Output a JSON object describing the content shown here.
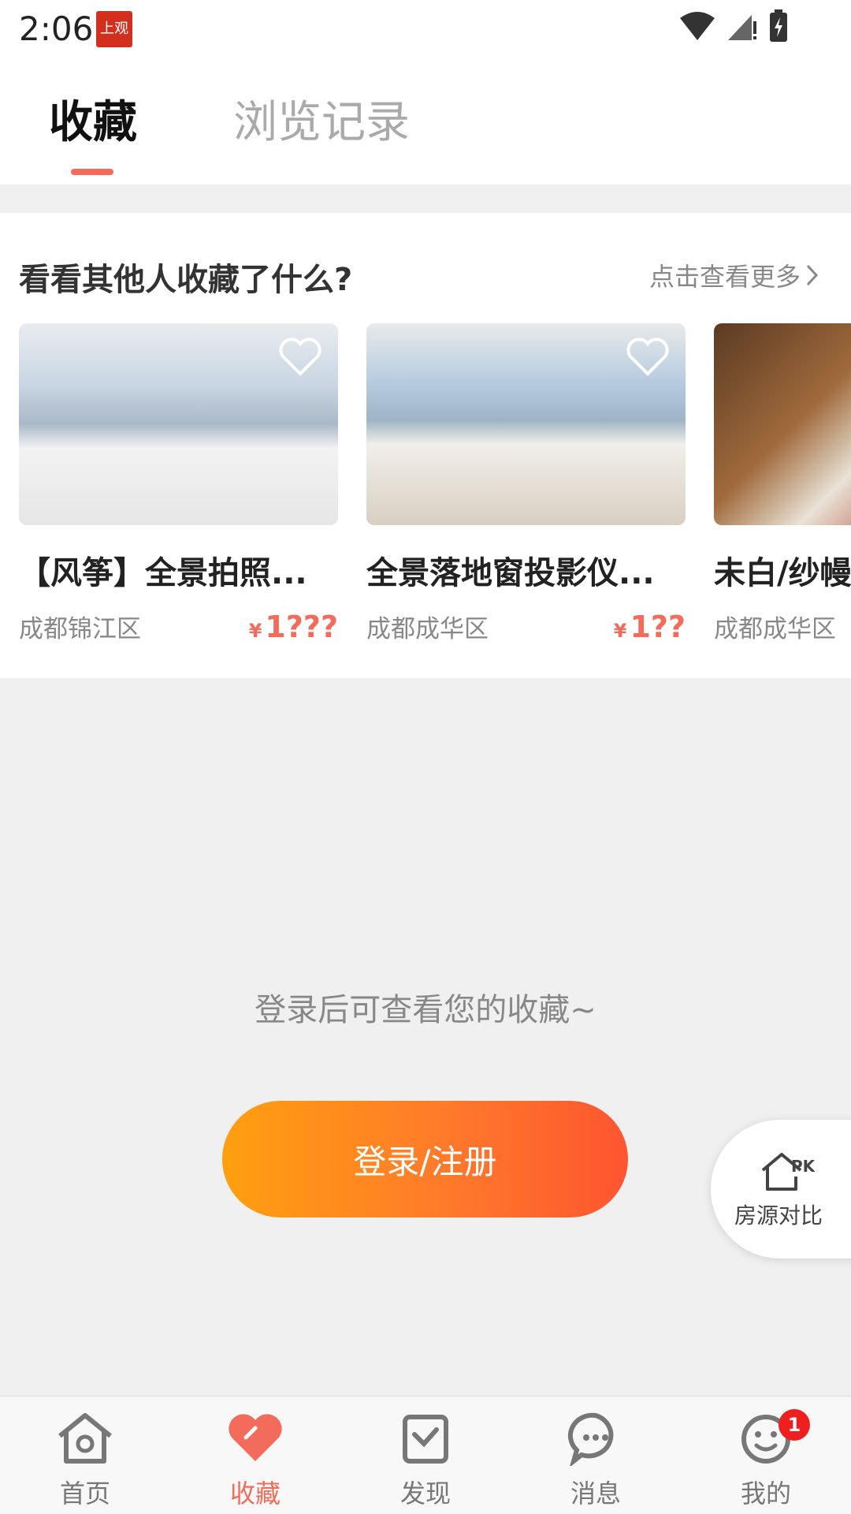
{
  "status_bar": {
    "time": "2:06",
    "app_icon_text": "上观"
  },
  "tabs": [
    {
      "label": "收藏",
      "active": true
    },
    {
      "label": "浏览记录",
      "active": false
    }
  ],
  "recommend": {
    "title": "看看其他人收藏了什么?",
    "more_label": "点击查看更多",
    "cards": [
      {
        "title": "【风筝】全景拍照...",
        "location": "成都锦江区",
        "price_symbol": "¥",
        "price": "1???"
      },
      {
        "title": "全景落地窗投影仪...",
        "location": "成都成华区",
        "price_symbol": "¥",
        "price": "1??"
      },
      {
        "title": "未白/纱幔",
        "location": "成都成华区",
        "price_symbol": "¥",
        "price": ""
      }
    ]
  },
  "empty_state": {
    "message": "登录后可查看您的收藏~",
    "login_button": "登录/注册"
  },
  "compare": {
    "icon_text": "PK",
    "label": "房源对比"
  },
  "bottom_nav": [
    {
      "label": "首页",
      "icon": "home-icon",
      "active": false
    },
    {
      "label": "收藏",
      "icon": "heart-icon",
      "active": true
    },
    {
      "label": "发现",
      "icon": "discover-icon",
      "active": false
    },
    {
      "label": "消息",
      "icon": "message-icon",
      "active": false
    },
    {
      "label": "我的",
      "icon": "profile-icon",
      "active": false,
      "badge": "1"
    }
  ],
  "colors": {
    "accent": "#f26b5b",
    "button_start": "#ff9f0f",
    "button_end": "#fe5530"
  }
}
